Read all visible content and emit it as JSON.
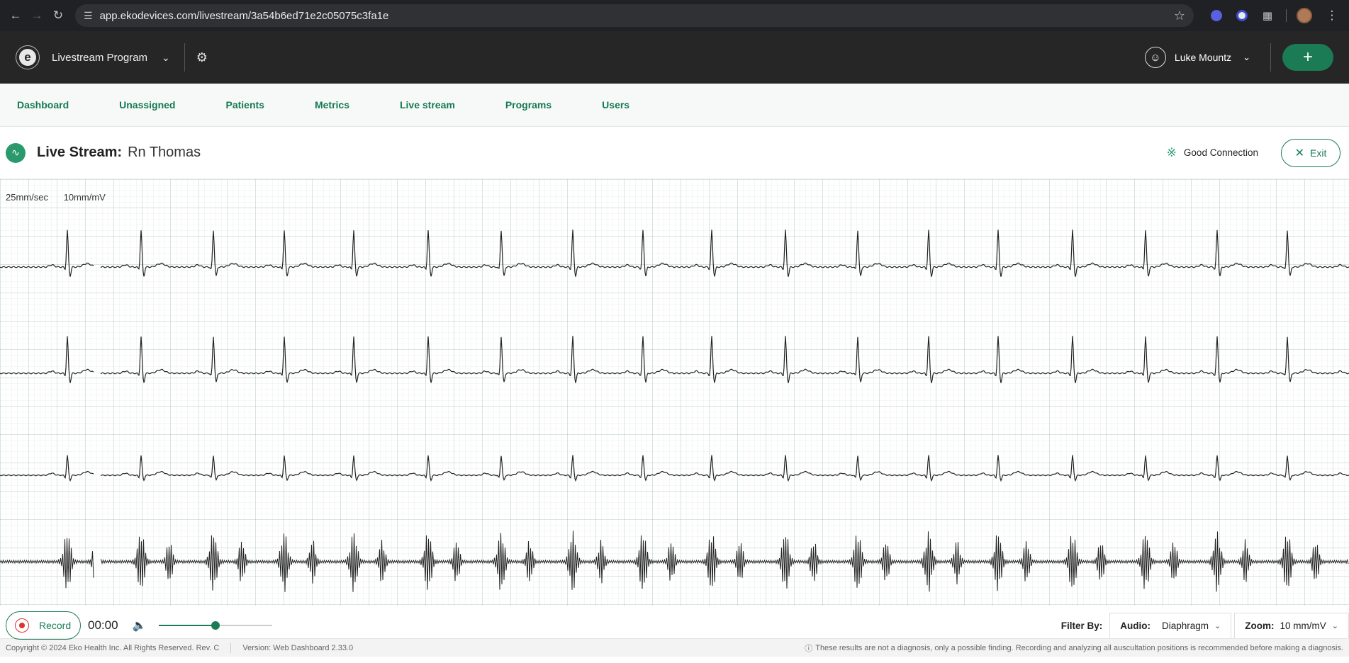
{
  "browser": {
    "url": "app.ekodevices.com/livestream/3a54b6ed71e2c05075c3fa1e"
  },
  "header": {
    "logo_letter": "e",
    "program": "Livestream Program",
    "user_name": "Luke Mountz"
  },
  "tabs": [
    "Dashboard",
    "Unassigned",
    "Patients",
    "Metrics",
    "Live stream",
    "Programs",
    "Users"
  ],
  "title": {
    "label": "Live Stream:",
    "name": "Rn Thomas",
    "connection": "Good Connection",
    "exit_label": "Exit"
  },
  "ecg": {
    "speed": "25mm/sec",
    "gain": "10mm/mV",
    "trace_color": "#222222"
  },
  "controls": {
    "record_label": "Record",
    "time": "00:00",
    "volume_fraction": 0.5,
    "filter_label": "Filter By:",
    "audio_label": "Audio:",
    "audio_value": "Diaphragm",
    "zoom_label": "Zoom:",
    "zoom_value": "10 mm/mV"
  },
  "footer": {
    "copyright": "Copyright © 2024 Eko Health Inc. All Rights Reserved. Rev. C",
    "version": "Version: Web Dashboard 2.33.0",
    "disclaimer": "These results are not a diagnosis, only a possible finding. Recording and analyzing all auscultation positions is recommended before making a diagnosis."
  },
  "colors": {
    "brand_green": "#1a7b55",
    "header_bg": "#262626"
  }
}
